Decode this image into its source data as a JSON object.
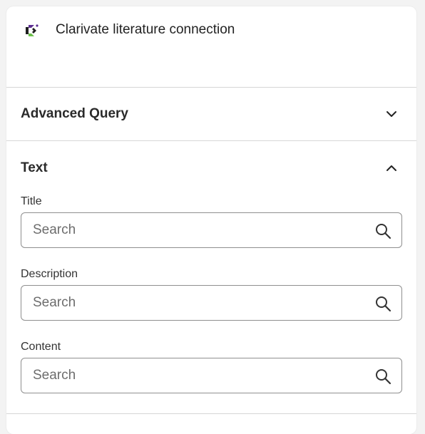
{
  "app": {
    "title": "Clarivate literature connection",
    "logo_colors": [
      "#5c2d91",
      "#6cc04a",
      "#1f1f1f"
    ]
  },
  "sections": {
    "advanced_query": {
      "label": "Advanced Query",
      "state": "collapsed",
      "icon": "chevron-down-icon"
    },
    "text": {
      "label": "Text",
      "state": "expanded",
      "icon": "chevron-up-icon",
      "fields": {
        "title": {
          "label": "Title",
          "placeholder": "Search",
          "value": ""
        },
        "description": {
          "label": "Description",
          "placeholder": "Search",
          "value": ""
        },
        "content": {
          "label": "Content",
          "placeholder": "Search",
          "value": ""
        }
      }
    }
  }
}
